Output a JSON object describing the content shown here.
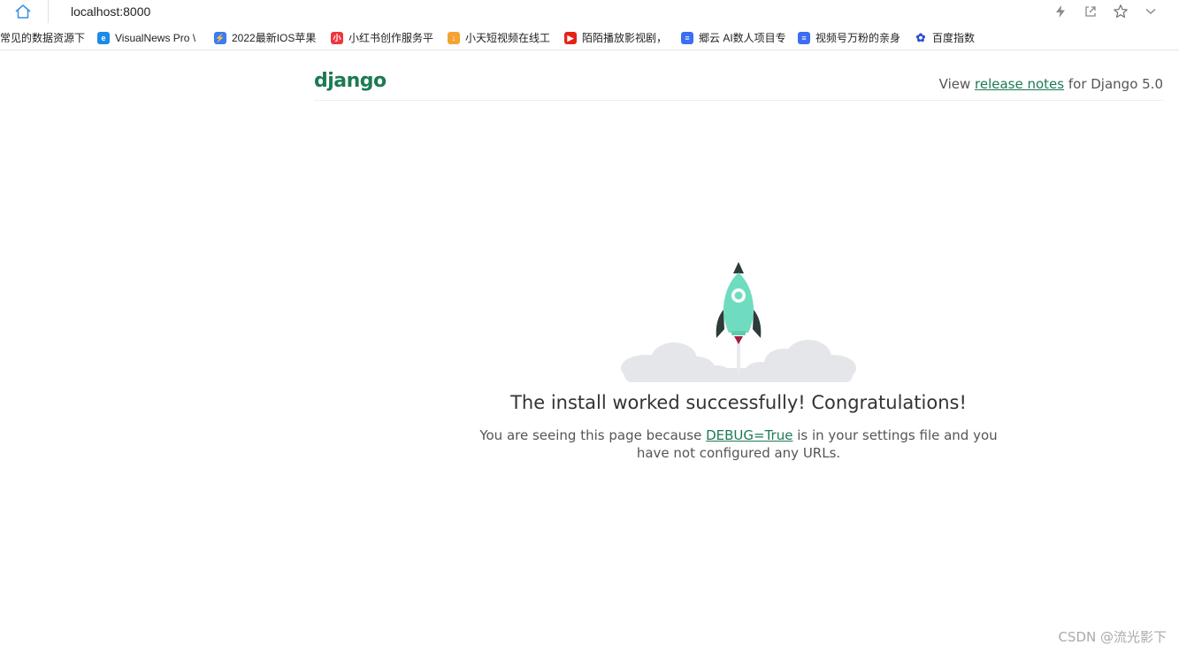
{
  "browser": {
    "url": "localhost:8000",
    "bookmarks": [
      {
        "label": "常见的数据资源下",
        "icon": "none",
        "color": ""
      },
      {
        "label": "VisualNews Pro \\",
        "icon": "e-icon",
        "color": "#1a8be6"
      },
      {
        "label": "2022最新IOS苹果",
        "icon": "bolt-icon",
        "color": "#3d7bf5"
      },
      {
        "label": "小红书创作服务平",
        "icon": "xiaohongshu-icon",
        "color": "#f0363c"
      },
      {
        "label": "小天短视频在线工",
        "icon": "download-icon",
        "color": "#f5a331"
      },
      {
        "label": "陌陌播放影视剧，",
        "icon": "youtube-icon",
        "color": "#e62117"
      },
      {
        "label": "郷云 AI数人项目专",
        "icon": "doc-icon",
        "color": "#3b6ef2"
      },
      {
        "label": "视频号万粉的亲身",
        "icon": "doc-icon",
        "color": "#3b6ef2"
      },
      {
        "label": "百度指数",
        "icon": "baidu-icon",
        "color": "#2b4bd1"
      }
    ]
  },
  "header": {
    "logo": "django",
    "release_prefix": "View ",
    "release_link": "release notes",
    "release_suffix": " for Django 5.0"
  },
  "main": {
    "title": "The install worked successfully! Congratulations!",
    "desc_prefix": "You are seeing this page because ",
    "desc_link": "DEBUG=True",
    "desc_suffix": " is in your settings file and you have not configured any URLs."
  },
  "watermark": "CSDN @流光影下",
  "colors": {
    "brand_green": "#1d7a55",
    "rocket_body": "#6fdcbf",
    "rocket_dark": "#2d3b3a",
    "flame": "#a31f43",
    "cloud": "#e4e6ea"
  }
}
